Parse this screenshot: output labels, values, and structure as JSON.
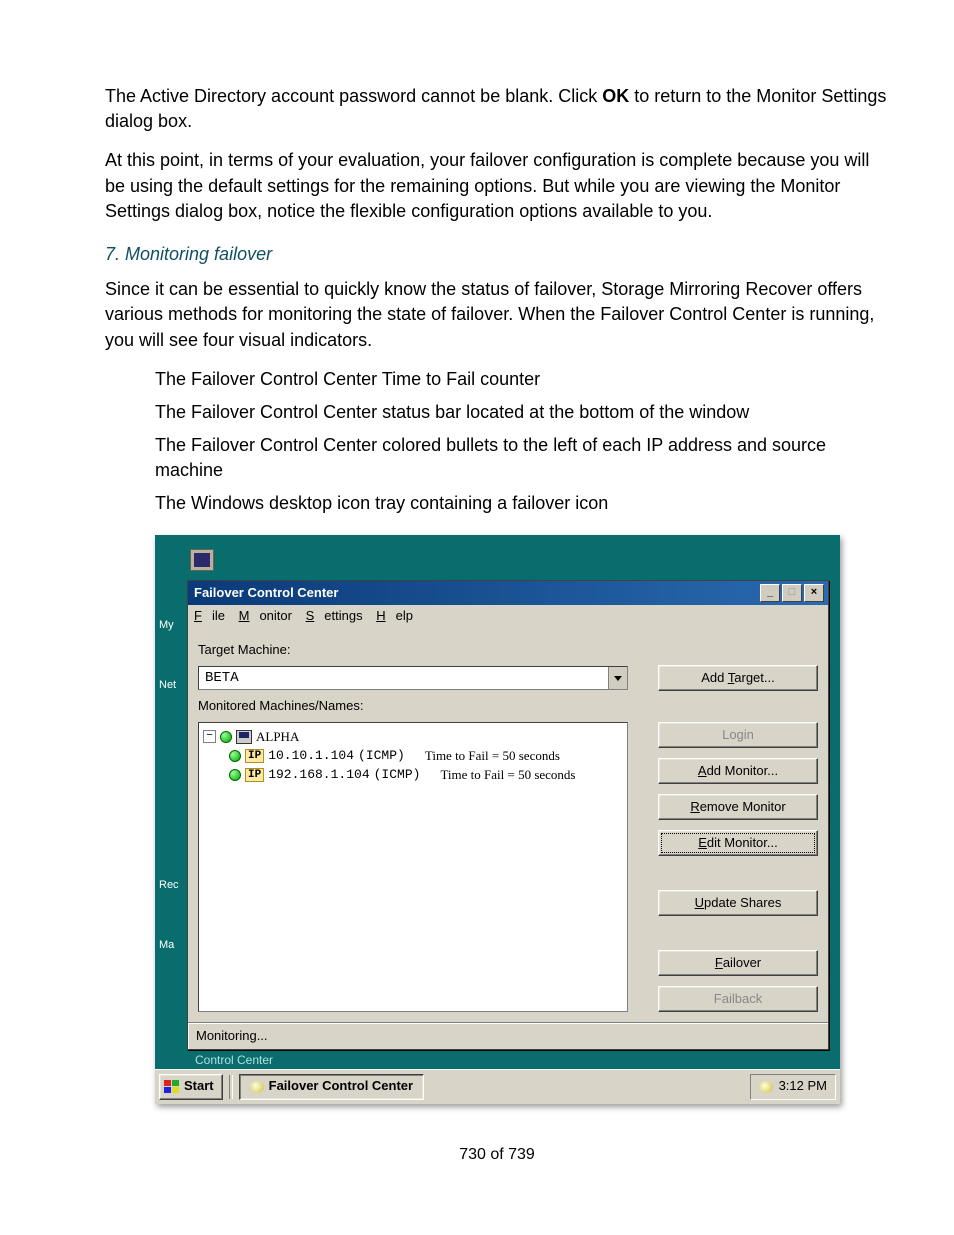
{
  "doc": {
    "p1_prefix": "The Active Directory account password cannot be blank. Click ",
    "p1_bold": "OK",
    "p1_suffix": " to return to the Monitor Settings dialog box.",
    "p2": "At this point, in terms of your evaluation, your failover configuration is complete because you will be using the default settings for the remaining options. But while you are viewing the Monitor Settings dialog box, notice the flexible configuration options available to you.",
    "heading": "7. Monitoring failover",
    "p3": "Since it can be essential to quickly know the status of failover, Storage Mirroring Recover offers various methods for monitoring the state of failover. When the Failover Control Center is running, you will see four visual indicators.",
    "li1": "The Failover Control Center Time to Fail counter",
    "li2": "The Failover Control Center status bar located at the bottom of the window",
    "li3": "The Failover Control Center colored bullets to the left of each IP address and source machine",
    "li4": "The Windows desktop icon tray containing a failover icon",
    "page_num": "730 of 739"
  },
  "desktop": {
    "icon1": "My",
    "icon2": "N",
    "icon2b": "Net",
    "icon3": "Rec",
    "icon4": "Ma",
    "footer": "Control Center"
  },
  "win": {
    "title": "Failover Control Center",
    "menu": {
      "file": "File",
      "file_u": "F",
      "monitor": "Monitor",
      "monitor_u": "M",
      "settings": "Settings",
      "settings_u": "S",
      "help": "Help",
      "help_u": "H"
    },
    "target_label": "Target Machine:",
    "target_value": "BETA",
    "monitored_label": "Monitored Machines/Names:",
    "tree": {
      "root": "ALPHA",
      "ip_label": "IP",
      "items": [
        {
          "ip": "10.10.1.104",
          "proto": "(ICMP)",
          "ttf": "Time to Fail = 50 seconds"
        },
        {
          "ip": "192.168.1.104",
          "proto": "(ICMP)",
          "ttf": "Time to Fail = 50 seconds"
        }
      ]
    },
    "buttons": {
      "add_target": "Add Target...",
      "login": "Login",
      "add_monitor": "Add Monitor...",
      "remove_monitor": "Remove Monitor",
      "edit_monitor": "Edit Monitor...",
      "update_shares": "Update Shares",
      "failover": "Failover",
      "failback": "Failback"
    },
    "status": "Monitoring..."
  },
  "taskbar": {
    "start": "Start",
    "task": "Failover Control Center",
    "time": "3:12 PM"
  }
}
